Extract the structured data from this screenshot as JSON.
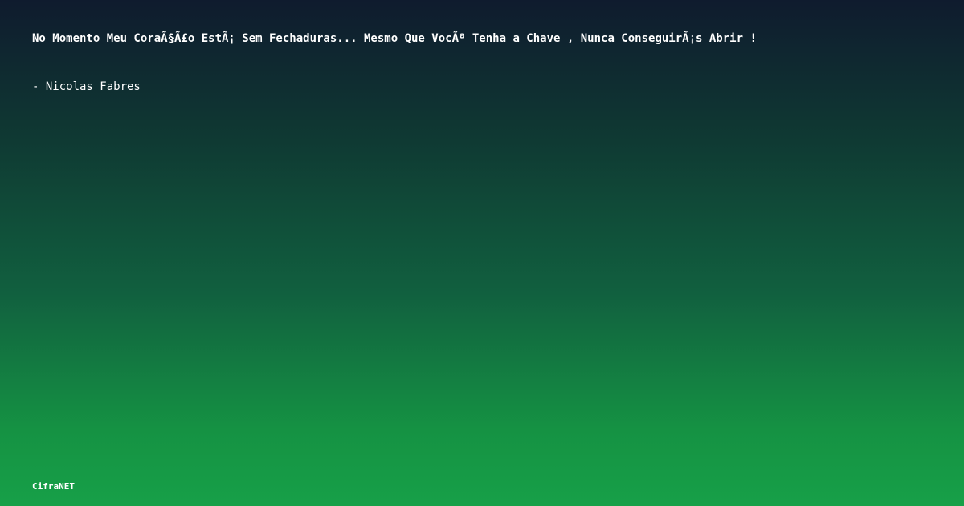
{
  "quote": {
    "text": "No Momento Meu CoraÃ§Ã£o EstÃ¡ Sem Fechaduras... Mesmo Que VocÃª Tenha a Chave , Nunca ConseguirÃ¡s Abrir !",
    "author": "- Nicolas Fabres"
  },
  "brand": {
    "name": "CifraNET"
  },
  "colors": {
    "gradient_top": "#0f1b2e",
    "gradient_bottom": "#17a048",
    "text": "#ffffff"
  }
}
